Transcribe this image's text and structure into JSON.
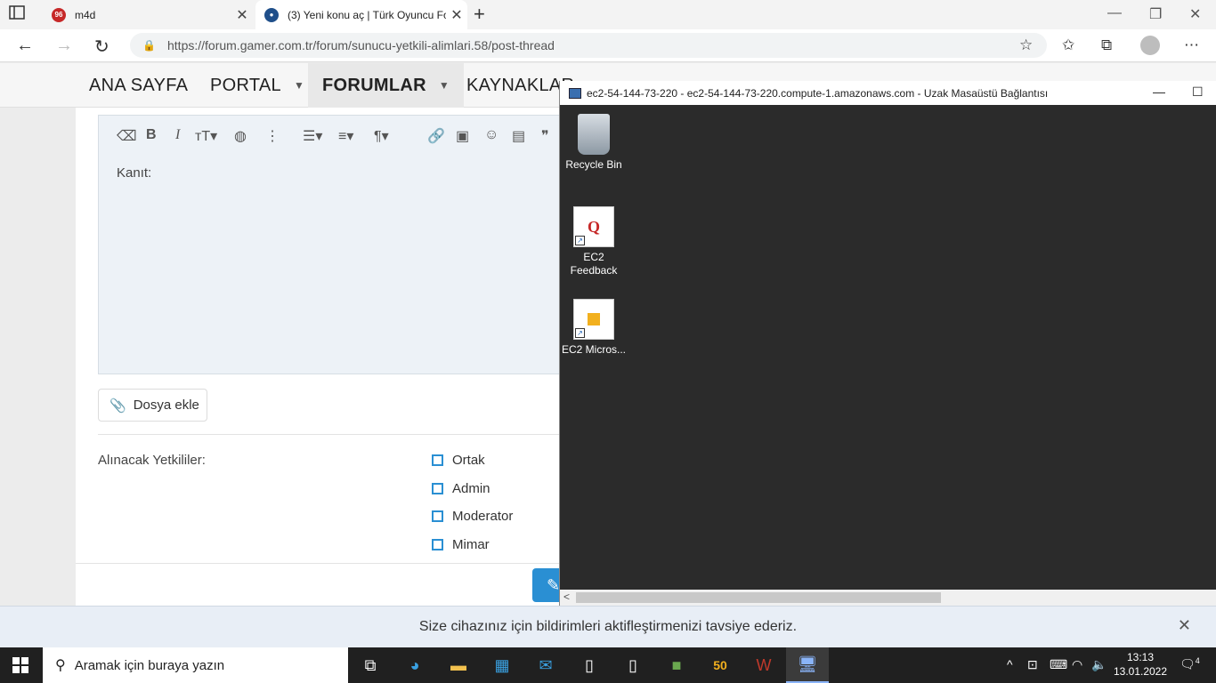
{
  "browser": {
    "tabs": [
      {
        "title": "m4d",
        "badge": "96"
      },
      {
        "title": "(3) Yeni konu aç | Türk Oyuncu Fo"
      }
    ],
    "url": "https://forum.gamer.com.tr/forum/sunucu-yetkili-alimlari.58/post-thread"
  },
  "site_nav": {
    "items": [
      "ANA SAYFA",
      "PORTAL",
      "FORUMLAR",
      "KAYNAKLAR"
    ]
  },
  "editor": {
    "content": "Kanıt:"
  },
  "attach_label": "Dosya ekle",
  "permissions": {
    "label": "Alınacak Yetkililer:",
    "options": [
      "Ortak",
      "Admin",
      "Moderator",
      "Mimar"
    ]
  },
  "rdp": {
    "title": "ec2-54-144-73-220 - ec2-54-144-73-220.compute-1.amazonaws.com - Uzak Masaüstü Bağlantısı",
    "icons": [
      "Recycle Bin",
      "EC2 Feedback",
      "EC2 Micros..."
    ]
  },
  "notification": "Size cihazınız için bildirimleri aktifleştirmenizi tavsiye ederiz.",
  "taskbar": {
    "search_placeholder": "Aramak için buraya yazın",
    "time": "13:13",
    "date": "13.01.2022",
    "notif_count": "4"
  },
  "colors": {
    "accent": "#2a8fd3",
    "rdp_desktop": "#2b2b2b",
    "taskbar": "#202020"
  }
}
